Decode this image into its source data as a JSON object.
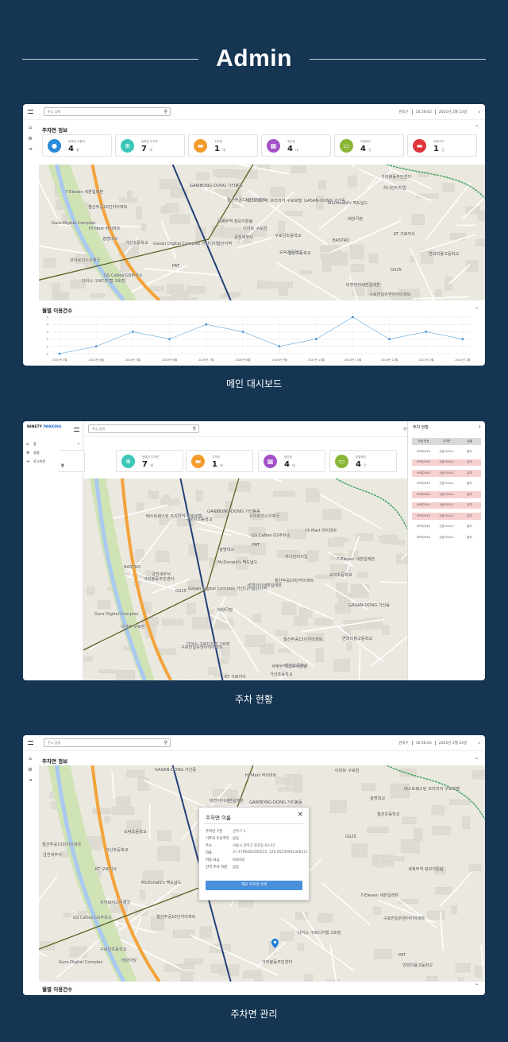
{
  "page_title": "Admin",
  "captions": {
    "dashboard": "메인 대시보드",
    "status": "주차 현황",
    "management": "주차면 관리"
  },
  "topbar": {
    "search_placeholder": "주소 검색",
    "district": "관악구",
    "time": "10:56:05",
    "date": "2021년 2월 23일"
  },
  "dashboard": {
    "section_title": "주차면 정보",
    "cards": [
      {
        "label": "등록된 사용자",
        "value": "4",
        "unit": "명",
        "color": "#2a8bd8",
        "icon": "user-icon"
      },
      {
        "label": "등록된 주차면",
        "value": "7",
        "unit": "개",
        "color": "#3cc7b8",
        "icon": "target-icon"
      },
      {
        "label": "주차중",
        "value": "1",
        "unit": "대",
        "color": "#f39c2c",
        "icon": "car-icon"
      },
      {
        "label": "정산중",
        "value": "4",
        "unit": "대",
        "color": "#a451c8",
        "icon": "calculator-icon"
      },
      {
        "label": "미결제건",
        "value": "4",
        "unit": "건",
        "color": "#8ab635",
        "icon": "card-icon"
      },
      {
        "label": "부정주차",
        "value": "1",
        "unit": "건",
        "color": "#e0343b",
        "icon": "car-warning-icon"
      }
    ],
    "chart_title": "월별 이용건수",
    "chart_data": {
      "type": "line",
      "categories": [
        "2020년 3월",
        "2020년 4월",
        "2020년 5월",
        "2020년 6월",
        "2020년 7월",
        "2020년 8월",
        "2020년 9월",
        "2020년 10월",
        "2020년 11월",
        "2020년 12월",
        "2021년 1월",
        "2021년 2월"
      ],
      "series": [
        {
          "values": [
            0,
            1,
            3,
            2,
            4,
            3,
            1,
            2,
            5,
            2,
            3,
            2
          ]
        }
      ],
      "ylim": [
        0,
        5
      ],
      "yticks": [
        "0",
        "1",
        "2",
        "3",
        "4",
        "5"
      ],
      "grid": true
    }
  },
  "status": {
    "logo_main": "NINETY",
    "logo_accent": "PARKING",
    "accent_color": "#2a6fd6",
    "menu": [
      {
        "label": "홈",
        "icon": "home-icon"
      },
      {
        "label": "설정",
        "icon": "gear-icon"
      },
      {
        "label": "로그아웃",
        "icon": "logout-icon"
      }
    ],
    "panel_title": "주차 현황",
    "panel_headers": [
      "차량 번호",
      "주차면",
      "입출"
    ],
    "panel_rows": [
      {
        "plate": "99허2345",
        "space": "신림-924-5",
        "io": "출차",
        "highlight": false
      },
      {
        "plate": "99허2345",
        "space": "신림-924-5",
        "io": "입차",
        "highlight": true
      },
      {
        "plate": "99허2345",
        "space": "신림-924-5",
        "io": "입차",
        "highlight": true
      },
      {
        "plate": "99허2345",
        "space": "신림-924-5",
        "io": "출차",
        "highlight": false
      },
      {
        "plate": "99허2345",
        "space": "신림-924-5",
        "io": "입차",
        "highlight": true
      },
      {
        "plate": "99허2345",
        "space": "신림-924-5",
        "io": "입차",
        "highlight": true
      },
      {
        "plate": "99허2345",
        "space": "신림-924-5",
        "io": "입차",
        "highlight": true
      },
      {
        "plate": "99허2345",
        "space": "신림-924-5",
        "io": "출차",
        "highlight": false
      },
      {
        "plate": "99허2345",
        "space": "신림-924-5",
        "io": "출차",
        "highlight": false
      }
    ]
  },
  "management": {
    "section_title": "주차면 정보",
    "bottom_title": "월별 이용건수",
    "popup": {
      "title": "주차면 이름",
      "rows": [
        {
          "k": "주차면 구분",
          "v": "관악구 1"
        },
        {
          "k": "거주자 우선주차",
          "v": "없음"
        },
        {
          "k": "주소",
          "v": "서울시 관악구 봉천동 63-22"
        },
        {
          "k": "좌표",
          "v": "37.4796483560525, 126.95259942348111"
        },
        {
          "k": "이용 요금",
          "v": "6000원"
        },
        {
          "k": "전역 주차 차량",
          "v": "없음"
        }
      ],
      "button": "해당 주차면 삭제"
    }
  },
  "map_labels": [
    "구로한일유앤아이아파트",
    "광명대교",
    "도덕초등학교",
    "7-Eleven 세븐일레븐",
    "GS25",
    "철산주공10단지아파트",
    "GS Caltex GS주유소",
    "Gasan Digital Complex 가산디지털단지역",
    "McDonald's 맥도날드",
    "철산주공13단지아파트",
    "GASAN-DONG 가산동",
    "비젼아이세븐일레븐",
    "PAT",
    "GARIBONG-DONG 가리봉동",
    "구로남초등학교",
    "유어로지스우체국",
    "BASTRO",
    "이마트 구로점",
    "Guro Digital Complex",
    "다이소 구로디지털 2호점",
    "가리봉동주민센터",
    "베스트웨스턴 프리미어 구로호텔",
    "태양극장",
    "연희미용고등학교",
    "KT 구로지사",
    "Hi Mart 하이마트",
    "가산초등학교",
    "금천세무서",
    "세계무역 정보지원팀",
    "하나인터지업",
    "철산초등학교"
  ]
}
